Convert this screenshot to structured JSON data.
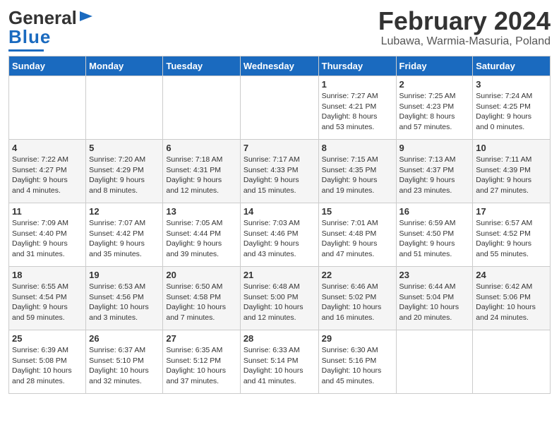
{
  "header": {
    "logo_general": "General",
    "logo_blue": "Blue",
    "title": "February 2024",
    "subtitle": "Lubawa, Warmia-Masuria, Poland"
  },
  "days_of_week": [
    "Sunday",
    "Monday",
    "Tuesday",
    "Wednesday",
    "Thursday",
    "Friday",
    "Saturday"
  ],
  "weeks": [
    [
      {
        "day": "",
        "info": ""
      },
      {
        "day": "",
        "info": ""
      },
      {
        "day": "",
        "info": ""
      },
      {
        "day": "",
        "info": ""
      },
      {
        "day": "1",
        "info": "Sunrise: 7:27 AM\nSunset: 4:21 PM\nDaylight: 8 hours\nand 53 minutes."
      },
      {
        "day": "2",
        "info": "Sunrise: 7:25 AM\nSunset: 4:23 PM\nDaylight: 8 hours\nand 57 minutes."
      },
      {
        "day": "3",
        "info": "Sunrise: 7:24 AM\nSunset: 4:25 PM\nDaylight: 9 hours\nand 0 minutes."
      }
    ],
    [
      {
        "day": "4",
        "info": "Sunrise: 7:22 AM\nSunset: 4:27 PM\nDaylight: 9 hours\nand 4 minutes."
      },
      {
        "day": "5",
        "info": "Sunrise: 7:20 AM\nSunset: 4:29 PM\nDaylight: 9 hours\nand 8 minutes."
      },
      {
        "day": "6",
        "info": "Sunrise: 7:18 AM\nSunset: 4:31 PM\nDaylight: 9 hours\nand 12 minutes."
      },
      {
        "day": "7",
        "info": "Sunrise: 7:17 AM\nSunset: 4:33 PM\nDaylight: 9 hours\nand 15 minutes."
      },
      {
        "day": "8",
        "info": "Sunrise: 7:15 AM\nSunset: 4:35 PM\nDaylight: 9 hours\nand 19 minutes."
      },
      {
        "day": "9",
        "info": "Sunrise: 7:13 AM\nSunset: 4:37 PM\nDaylight: 9 hours\nand 23 minutes."
      },
      {
        "day": "10",
        "info": "Sunrise: 7:11 AM\nSunset: 4:39 PM\nDaylight: 9 hours\nand 27 minutes."
      }
    ],
    [
      {
        "day": "11",
        "info": "Sunrise: 7:09 AM\nSunset: 4:40 PM\nDaylight: 9 hours\nand 31 minutes."
      },
      {
        "day": "12",
        "info": "Sunrise: 7:07 AM\nSunset: 4:42 PM\nDaylight: 9 hours\nand 35 minutes."
      },
      {
        "day": "13",
        "info": "Sunrise: 7:05 AM\nSunset: 4:44 PM\nDaylight: 9 hours\nand 39 minutes."
      },
      {
        "day": "14",
        "info": "Sunrise: 7:03 AM\nSunset: 4:46 PM\nDaylight: 9 hours\nand 43 minutes."
      },
      {
        "day": "15",
        "info": "Sunrise: 7:01 AM\nSunset: 4:48 PM\nDaylight: 9 hours\nand 47 minutes."
      },
      {
        "day": "16",
        "info": "Sunrise: 6:59 AM\nSunset: 4:50 PM\nDaylight: 9 hours\nand 51 minutes."
      },
      {
        "day": "17",
        "info": "Sunrise: 6:57 AM\nSunset: 4:52 PM\nDaylight: 9 hours\nand 55 minutes."
      }
    ],
    [
      {
        "day": "18",
        "info": "Sunrise: 6:55 AM\nSunset: 4:54 PM\nDaylight: 9 hours\nand 59 minutes."
      },
      {
        "day": "19",
        "info": "Sunrise: 6:53 AM\nSunset: 4:56 PM\nDaylight: 10 hours\nand 3 minutes."
      },
      {
        "day": "20",
        "info": "Sunrise: 6:50 AM\nSunset: 4:58 PM\nDaylight: 10 hours\nand 7 minutes."
      },
      {
        "day": "21",
        "info": "Sunrise: 6:48 AM\nSunset: 5:00 PM\nDaylight: 10 hours\nand 12 minutes."
      },
      {
        "day": "22",
        "info": "Sunrise: 6:46 AM\nSunset: 5:02 PM\nDaylight: 10 hours\nand 16 minutes."
      },
      {
        "day": "23",
        "info": "Sunrise: 6:44 AM\nSunset: 5:04 PM\nDaylight: 10 hours\nand 20 minutes."
      },
      {
        "day": "24",
        "info": "Sunrise: 6:42 AM\nSunset: 5:06 PM\nDaylight: 10 hours\nand 24 minutes."
      }
    ],
    [
      {
        "day": "25",
        "info": "Sunrise: 6:39 AM\nSunset: 5:08 PM\nDaylight: 10 hours\nand 28 minutes."
      },
      {
        "day": "26",
        "info": "Sunrise: 6:37 AM\nSunset: 5:10 PM\nDaylight: 10 hours\nand 32 minutes."
      },
      {
        "day": "27",
        "info": "Sunrise: 6:35 AM\nSunset: 5:12 PM\nDaylight: 10 hours\nand 37 minutes."
      },
      {
        "day": "28",
        "info": "Sunrise: 6:33 AM\nSunset: 5:14 PM\nDaylight: 10 hours\nand 41 minutes."
      },
      {
        "day": "29",
        "info": "Sunrise: 6:30 AM\nSunset: 5:16 PM\nDaylight: 10 hours\nand 45 minutes."
      },
      {
        "day": "",
        "info": ""
      },
      {
        "day": "",
        "info": ""
      }
    ]
  ]
}
